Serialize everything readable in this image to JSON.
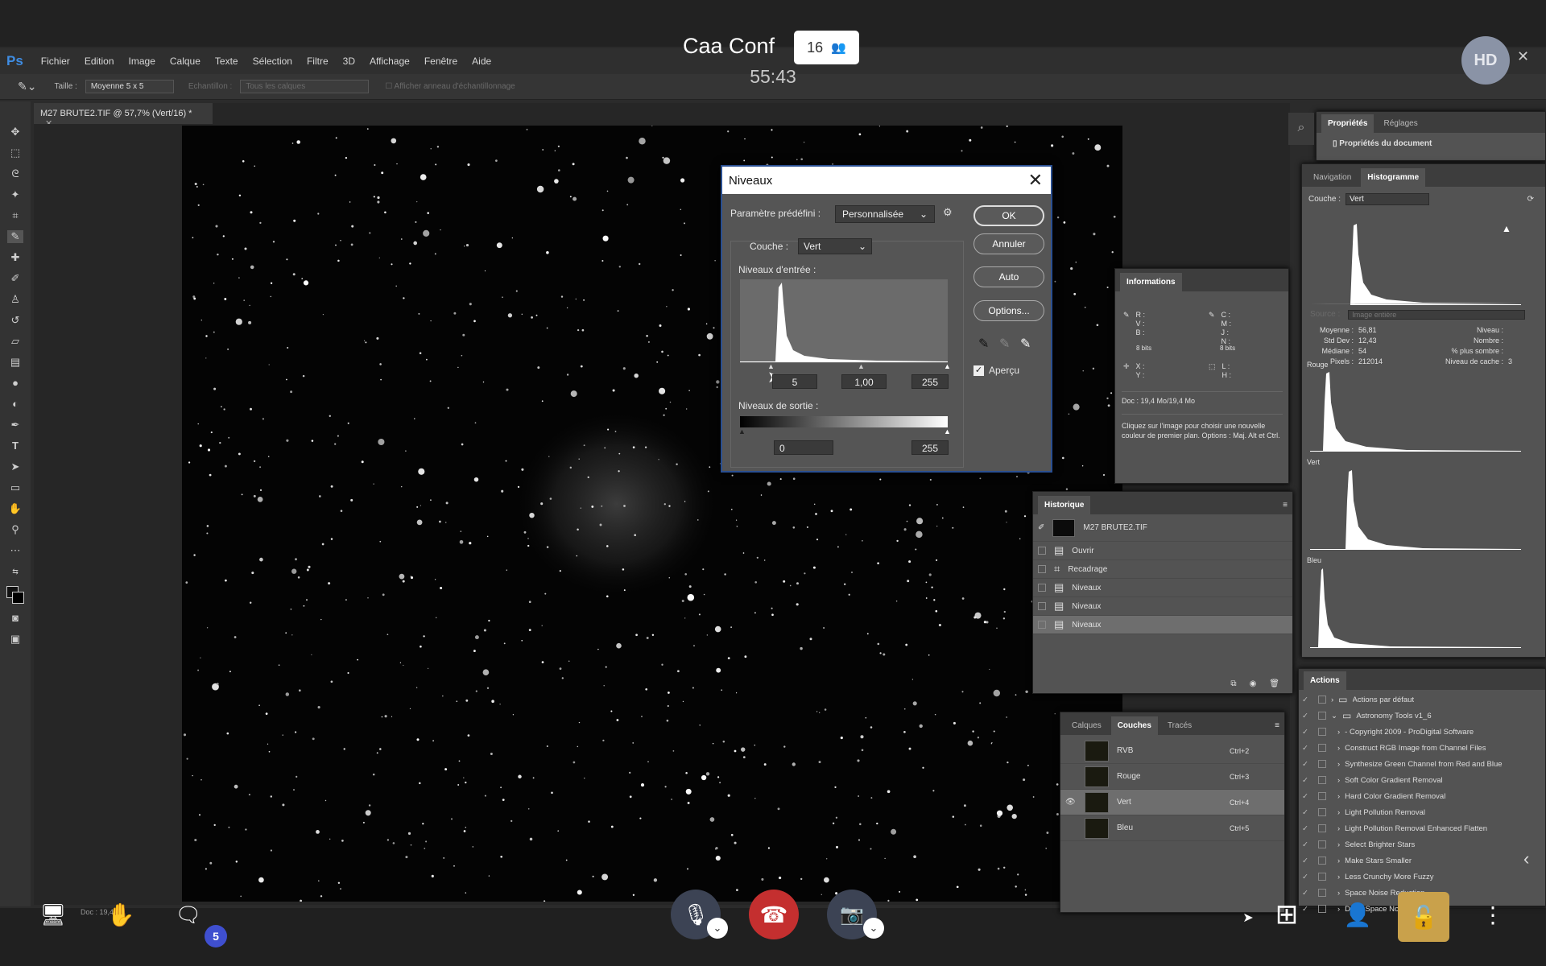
{
  "conference": {
    "title": "Caa Conf",
    "participants": "16",
    "timer": "55:43",
    "avatar": "HD",
    "chat_badge": "5"
  },
  "photoshop": {
    "logo": "Ps",
    "menu": [
      "Fichier",
      "Edition",
      "Image",
      "Calque",
      "Texte",
      "Sélection",
      "Filtre",
      "3D",
      "Affichage",
      "Fenêtre",
      "Aide"
    ],
    "options": {
      "size_label": "Taille :",
      "size_value": "Moyenne 5 x 5",
      "sample_label": "Echantillon :",
      "sample_value": "Tous les calques",
      "ring_label": "Afficher anneau d'échantillonnage"
    },
    "doc_tab": "M27 BRUTE2.TIF @ 57,7% (Vert/16) *",
    "status": "Doc : 19,4 M"
  },
  "levels": {
    "title": "Niveaux",
    "preset_label": "Paramètre prédéfini :",
    "preset_value": "Personnalisée",
    "channel_label": "Couche :",
    "channel_value": "Vert",
    "input_label": "Niveaux d'entrée :",
    "input_black": "5",
    "input_gamma": "1,00",
    "input_white": "255",
    "output_label": "Niveaux de sortie :",
    "output_black": "0",
    "output_white": "255",
    "ok": "OK",
    "cancel": "Annuler",
    "auto": "Auto",
    "options": "Options...",
    "preview": "Aperçu"
  },
  "properties": {
    "tabs": [
      "Propriétés",
      "Réglages"
    ],
    "doc_props": "Propriétés du document"
  },
  "histogram": {
    "tabs": [
      "Navigation",
      "Histogramme"
    ],
    "channel_label": "Couche :",
    "channel_value": "Vert",
    "source_label": "Source :",
    "source_value": "Image entière",
    "stats_left": [
      [
        "Moyenne :",
        "56,81"
      ],
      [
        "Std Dev :",
        "12,43"
      ],
      [
        "Médiane :",
        "54"
      ],
      [
        "Pixels :",
        "212014"
      ]
    ],
    "stats_right": [
      [
        "Niveau :",
        ""
      ],
      [
        "Nombre :",
        ""
      ],
      [
        "% plus sombre :",
        ""
      ],
      [
        "Niveau de cache :",
        "3"
      ]
    ],
    "channels": [
      "Rouge",
      "Vert",
      "Bleu"
    ]
  },
  "info": {
    "title": "Informations",
    "rgb": "R :\nV :\nB :",
    "cmyk": "C :\nM :\nJ :\nN :",
    "bits_left": "8 bits",
    "bits_right": "8 bits",
    "xy": "X :\nY :",
    "lh": "L :\nH :",
    "doc": "Doc : 19,4 Mo/19,4 Mo",
    "hint": "Cliquez sur l'image pour choisir une nouvelle couleur de premier plan. Options : Maj. Alt et Ctrl."
  },
  "history": {
    "title": "Historique",
    "snapshot": "M27 BRUTE2.TIF",
    "items": [
      "Ouvrir",
      "Recadrage",
      "Niveaux",
      "Niveaux",
      "Niveaux"
    ]
  },
  "channels_panel": {
    "tabs": [
      "Calques",
      "Couches",
      "Tracés"
    ],
    "rows": [
      [
        "RVB",
        "Ctrl+2"
      ],
      [
        "Rouge",
        "Ctrl+3"
      ],
      [
        "Vert",
        "Ctrl+4"
      ],
      [
        "Bleu",
        "Ctrl+5"
      ]
    ]
  },
  "actions": {
    "title": "Actions",
    "items": [
      "Actions par défaut",
      "Astronomy Tools v1_6",
      "- Copyright 2009 - ProDigital Software",
      "Construct RGB Image from Channel Files",
      "Synthesize Green Channel from Red and Blue",
      "Soft Color Gradient Removal",
      "Hard Color Gradient Removal",
      "Light Pollution Removal",
      "Light Pollution Removal Enhanced Flatten",
      "Select Brighter Stars",
      "Make Stars Smaller",
      "Less Crunchy More Fuzzy",
      "Space Noise Reduction",
      "Deep Space Noise Reduction"
    ]
  },
  "colors": {
    "hangup": "#c42f2f",
    "accent": "#3f4fcf",
    "lock": "#c9a14b"
  }
}
